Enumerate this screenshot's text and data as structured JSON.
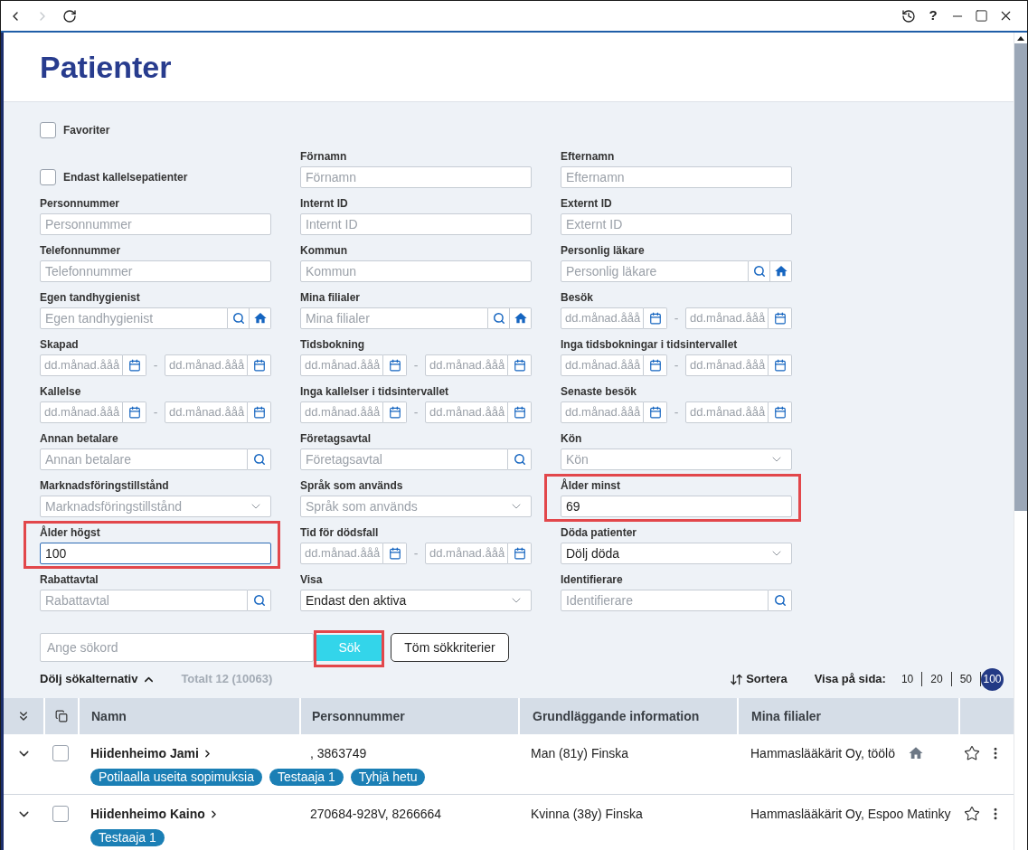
{
  "title_bar": {
    "nav_buttons": [
      {
        "kind": "back",
        "disabled": false
      },
      {
        "kind": "forward",
        "disabled": true
      },
      {
        "kind": "refresh",
        "disabled": false
      }
    ],
    "help_label": "?"
  },
  "page_title": "Patienter",
  "filter_rows": [
    [
      {
        "kind": "checkbox",
        "label": "Favoriter",
        "checked": false,
        "highlighted": false
      }
    ],
    [
      {
        "kind": "checkbox",
        "label": "Endast kallelsepatienter",
        "checked": false,
        "highlighted": false
      },
      {
        "kind": "text",
        "label": "Förnamn",
        "placeholder": "Förnamn",
        "focused": false,
        "highlighted": false
      },
      {
        "kind": "text",
        "label": "Efternamn",
        "placeholder": "Efternamn",
        "focused": false,
        "highlighted": false
      }
    ],
    [
      {
        "kind": "text",
        "label": "Personnummer",
        "placeholder": "Personnummer",
        "focused": false,
        "highlighted": false
      },
      {
        "kind": "text",
        "label": "Internt ID",
        "placeholder": "Internt ID",
        "focused": false,
        "highlighted": false
      },
      {
        "kind": "text",
        "label": "Externt ID",
        "placeholder": "Externt ID",
        "focused": false,
        "highlighted": false
      }
    ],
    [
      {
        "kind": "text",
        "label": "Telefonnummer",
        "placeholder": "Telefonnummer",
        "focused": false,
        "highlighted": false
      },
      {
        "kind": "text",
        "label": "Kommun",
        "placeholder": "Kommun",
        "focused": false,
        "highlighted": false
      },
      {
        "kind": "lookup_home",
        "label": "Personlig läkare",
        "placeholder": "Personlig läkare",
        "highlighted": false
      }
    ],
    [
      {
        "kind": "lookup_home",
        "label": "Egen tandhygienist",
        "placeholder": "Egen tandhygienist",
        "highlighted": false
      },
      {
        "kind": "lookup_home",
        "label": "Mina filialer",
        "placeholder": "Mina filialer",
        "highlighted": false
      },
      {
        "kind": "date_range",
        "label": "Besök",
        "from_placeholder": "dd.månad.ååå",
        "separator": "-",
        "to_placeholder": "dd.månad.ååå",
        "highlighted": false
      }
    ],
    [
      {
        "kind": "date_range",
        "label": "Skapad",
        "from_placeholder": "dd.månad.ååå",
        "separator": "-",
        "to_placeholder": "dd.månad.ååå",
        "highlighted": false
      },
      {
        "kind": "date_range",
        "label": "Tidsbokning",
        "from_placeholder": "dd.månad.ååå",
        "separator": "-",
        "to_placeholder": "dd.månad.ååå",
        "highlighted": false
      },
      {
        "kind": "date_range",
        "label": "Inga tidsbokningar i tidsintervallet",
        "from_placeholder": "dd.månad.ååå",
        "separator": "-",
        "to_placeholder": "dd.månad.ååå",
        "highlighted": false
      }
    ],
    [
      {
        "kind": "date_range",
        "label": "Kallelse",
        "from_placeholder": "dd.månad.ååå",
        "separator": "-",
        "to_placeholder": "dd.månad.ååå",
        "highlighted": false
      },
      {
        "kind": "date_range",
        "label": "Inga kallelser i tidsintervallet",
        "from_placeholder": "dd.månad.ååå",
        "separator": "-",
        "to_placeholder": "dd.månad.ååå",
        "highlighted": false
      },
      {
        "kind": "date_range",
        "label": "Senaste besök",
        "from_placeholder": "dd.månad.ååå",
        "separator": "-",
        "to_placeholder": "dd.månad.ååå",
        "highlighted": false
      }
    ],
    [
      {
        "kind": "lookup",
        "label": "Annan betalare",
        "placeholder": "Annan betalare",
        "highlighted": false
      },
      {
        "kind": "lookup",
        "label": "Företagsavtal",
        "placeholder": "Företagsavtal",
        "highlighted": false
      },
      {
        "kind": "select",
        "label": "Kön",
        "placeholder": "Kön",
        "highlighted": false
      }
    ],
    [
      {
        "kind": "select",
        "label": "Marknadsföringstillstånd",
        "placeholder": "Marknadsföringstillstånd",
        "highlighted": false
      },
      {
        "kind": "select",
        "label": "Språk som används",
        "placeholder": "Språk som används",
        "highlighted": false
      },
      {
        "kind": "text",
        "label": "Ålder minst",
        "value": "69",
        "focused": false,
        "highlighted": true
      }
    ],
    [
      {
        "kind": "text",
        "label": "Ålder högst",
        "value": "100",
        "focused": true,
        "highlighted": true
      },
      {
        "kind": "date_range",
        "label": "Tid för dödsfall",
        "from_placeholder": "dd.månad.ååå",
        "separator": "-",
        "to_placeholder": "dd.månad.ååå",
        "highlighted": false
      },
      {
        "kind": "select",
        "label": "Döda patienter",
        "value": "Dölj döda",
        "highlighted": false
      }
    ],
    [
      {
        "kind": "lookup",
        "label": "Rabattavtal",
        "placeholder": "Rabattavtal",
        "highlighted": false
      },
      {
        "kind": "select",
        "label": "Visa",
        "value": "Endast den aktiva",
        "highlighted": false
      },
      {
        "kind": "lookup",
        "label": "Identifierare",
        "placeholder": "Identifierare",
        "highlighted": false
      }
    ]
  ],
  "keyword_search": {
    "placeholder": "Ange sökord",
    "highlighted": false
  },
  "search_button": {
    "label": "Sök",
    "highlighted": true
  },
  "clear_button": {
    "label": "Töm sökkriterier",
    "highlighted": false
  },
  "results_bar": {
    "toggle_label": "Dölj sökalternativ",
    "expanded": true,
    "total": "Totalt 12 (10063)",
    "sort_label": "Sortera",
    "page_size_label": "Visa på sida:",
    "page_sizes": [
      {
        "label": "10",
        "selected": false
      },
      {
        "label": "20",
        "selected": false
      },
      {
        "label": "50",
        "selected": false
      },
      {
        "label": "100",
        "selected": true
      }
    ]
  },
  "table": {
    "columns": [
      "Namn",
      "Personnummer",
      "Grundläggande information",
      "Mina filialer"
    ],
    "rows": [
      {
        "name": "Hiidenheimo Jami",
        "personnummer": ", 3863749",
        "info": "Man (81y) Finska",
        "branch": "Hammaslääkärit Oy, töölö",
        "home_branch": true,
        "tags": [
          "Potilaalla useita sopimuksia",
          "Testaaja 1",
          "Tyhjä hetu"
        ],
        "checked": false,
        "favorite": false,
        "expanded": false
      },
      {
        "name": "Hiidenheimo Kaino",
        "personnummer": "270684-928V, 8266664",
        "info": "Kvinna (38y) Finska",
        "branch": "Hammaslääkärit Oy, Espoo Matinky",
        "home_branch": false,
        "tags": [
          "Testaaja 1"
        ],
        "checked": false,
        "favorite": false,
        "expanded": false
      }
    ]
  }
}
